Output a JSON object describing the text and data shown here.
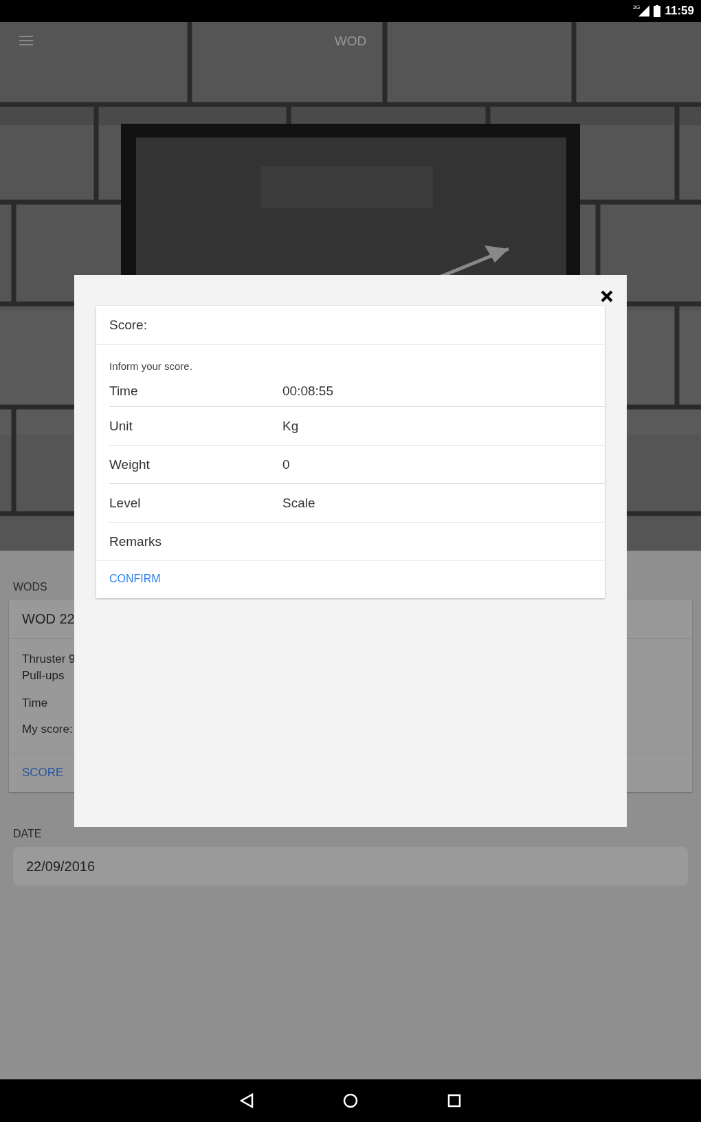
{
  "status_bar": {
    "network": "3G",
    "time": "11:59"
  },
  "app_bar": {
    "title": "WOD"
  },
  "wods": {
    "label": "WODS",
    "card": {
      "title": "WOD 22",
      "exercises": [
        "Thruster 9",
        "Pull-ups"
      ],
      "type": "Time",
      "my_score": "My score:",
      "action": "SCORE"
    }
  },
  "date": {
    "label": "DATE",
    "value": "22/09/2016"
  },
  "dialog": {
    "title": "Score:",
    "hint": "Inform your score.",
    "fields": [
      {
        "label": "Time",
        "value": "00:08:55"
      },
      {
        "label": "Unit",
        "value": "Kg"
      },
      {
        "label": "Weight",
        "value": "0"
      },
      {
        "label": "Level",
        "value": "Scale"
      },
      {
        "label": "Remarks"
      }
    ],
    "confirm": "CONFIRM"
  }
}
